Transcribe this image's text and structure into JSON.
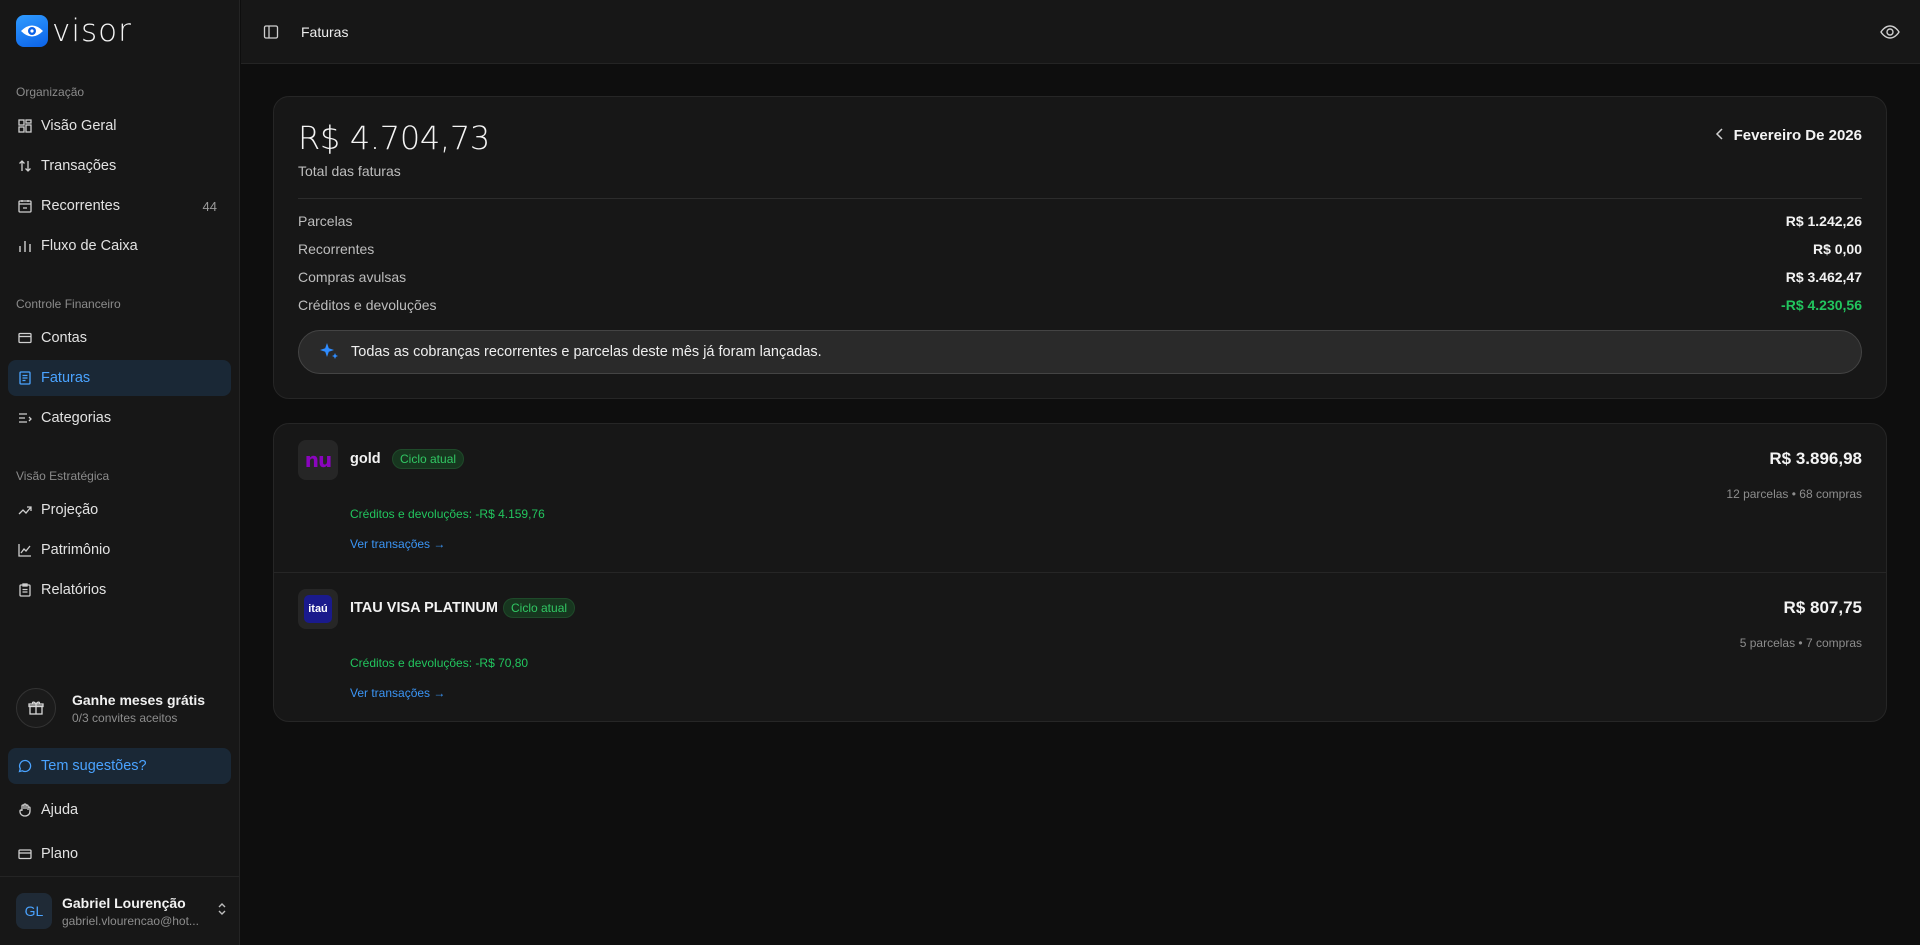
{
  "app": {
    "name": "visor"
  },
  "topbar": {
    "breadcrumb": "Faturas"
  },
  "sidebar": {
    "sections": [
      {
        "label": "Organização"
      },
      {
        "label": "Controle Financeiro"
      },
      {
        "label": "Visão Estratégica"
      }
    ],
    "items": [
      {
        "label": "Visão Geral",
        "icon": "dashboard-icon"
      },
      {
        "label": "Transações",
        "icon": "arrows-updown-icon"
      },
      {
        "label": "Recorrentes",
        "icon": "calendar-repeat-icon",
        "count": "44"
      },
      {
        "label": "Fluxo de Caixa",
        "icon": "bar-chart-icon"
      },
      {
        "label": "Contas",
        "icon": "wallet-icon"
      },
      {
        "label": "Faturas",
        "icon": "receipt-icon",
        "active": true
      },
      {
        "label": "Categorias",
        "icon": "list-filter-icon"
      },
      {
        "label": "Projeção",
        "icon": "trending-up-icon"
      },
      {
        "label": "Patrimônio",
        "icon": "chart-line-icon"
      },
      {
        "label": "Relatórios",
        "icon": "clipboard-icon"
      }
    ],
    "invite": {
      "title": "Ganhe meses grátis",
      "subtitle": "0/3 convites aceitos"
    },
    "footer_items": [
      {
        "label": "Tem sugestões?",
        "icon": "message-icon",
        "highlight": true
      },
      {
        "label": "Ajuda",
        "icon": "hand-icon"
      },
      {
        "label": "Plano",
        "icon": "credit-card-icon"
      }
    ],
    "user": {
      "initials": "GL",
      "name": "Gabriel Lourenção",
      "email": "gabriel.vlourencao@hot..."
    }
  },
  "summary": {
    "total": "R$ 4.704,73",
    "total_label": "Total das faturas",
    "period": "Fevereiro De 2026",
    "rows": [
      {
        "label": "Parcelas",
        "value": "R$ 1.242,26"
      },
      {
        "label": "Recorrentes",
        "value": "R$ 0,00"
      },
      {
        "label": "Compras avulsas",
        "value": "R$ 3.462,47"
      },
      {
        "label": "Créditos e devoluções",
        "value": "-R$ 4.230,56"
      }
    ],
    "notice": "Todas as cobranças recorrentes e parcelas deste mês já foram lançadas."
  },
  "cards": [
    {
      "logo_text": "nu",
      "name": "gold",
      "badge": "Ciclo atual",
      "amount": "R$ 3.896,98",
      "meta": "12 parcelas • 68 compras",
      "credits": "Créditos e devoluções: -R$ 4.159,76",
      "link": "Ver transações →"
    },
    {
      "logo_text": "itaú",
      "name": "ITAU VISA PLATINUM",
      "badge": "Ciclo atual",
      "amount": "R$ 807,75",
      "meta": "5 parcelas • 7 compras",
      "credits": "Créditos e devoluções: -R$ 70,80",
      "link": "Ver transações →"
    }
  ],
  "colors": {
    "accent": "#4aa3ff",
    "positive": "#22c55e",
    "background": "#0e0e0e",
    "surface": "#171717"
  }
}
